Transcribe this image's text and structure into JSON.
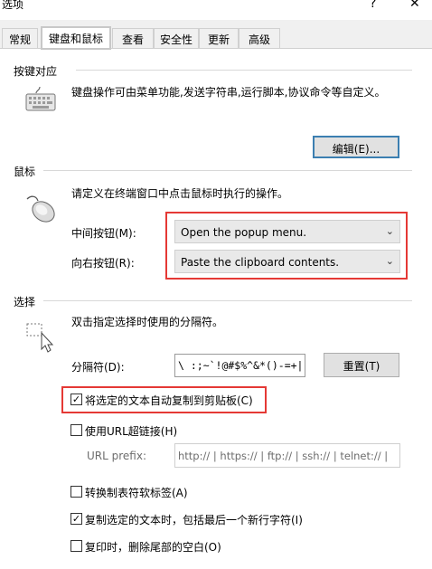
{
  "window": {
    "title": "选项",
    "help": "?",
    "close": "✕"
  },
  "tabs": [
    {
      "label": "常规"
    },
    {
      "label": "键盘和鼠标"
    },
    {
      "label": "查看"
    },
    {
      "label": "安全性"
    },
    {
      "label": "更新"
    },
    {
      "label": "高级"
    }
  ],
  "keyboard": {
    "title": "按键对应",
    "description": "键盘操作可由菜单功能,发送字符串,运行脚本,协议命令等自定义。",
    "edit_button": "编辑(E)..."
  },
  "mouse": {
    "title": "鼠标",
    "description": "请定义在终端窗口中点击鼠标时执行的操作。",
    "middle_label": "中间按钮(M):",
    "middle_value": "Open the popup menu.",
    "right_label": "向右按钮(R):",
    "right_value": "Paste the clipboard contents."
  },
  "selection": {
    "title": "选择",
    "description": "双击指定选择时使用的分隔符。",
    "delimiter_label": "分隔符(D):",
    "delimiter_value": "\\ :;~`!@#$%^&*()-=+|[]{}",
    "reset_button": "重置(T)",
    "auto_copy": {
      "label": "将选定的文本自动复制到剪贴板(C)",
      "checked": true
    },
    "use_url": {
      "label": "使用URL超链接(H)",
      "checked": false
    },
    "url_prefix_label": "URL prefix:",
    "url_prefix_value": "http:// | https:// | ftp:// | ssh:// | telnet:// |",
    "tab_soft": {
      "label": "转换制表符软标签(A)",
      "checked": false
    },
    "copy_newline": {
      "label": "复制选定的文本时，包括最后一个新行字符(I)",
      "checked": true
    },
    "trim_trailing": {
      "label": "复印时，删除尾部的空白(O)",
      "checked": false
    }
  },
  "colors": {
    "highlight": "#e53935",
    "focus": "#3c7fb1"
  }
}
